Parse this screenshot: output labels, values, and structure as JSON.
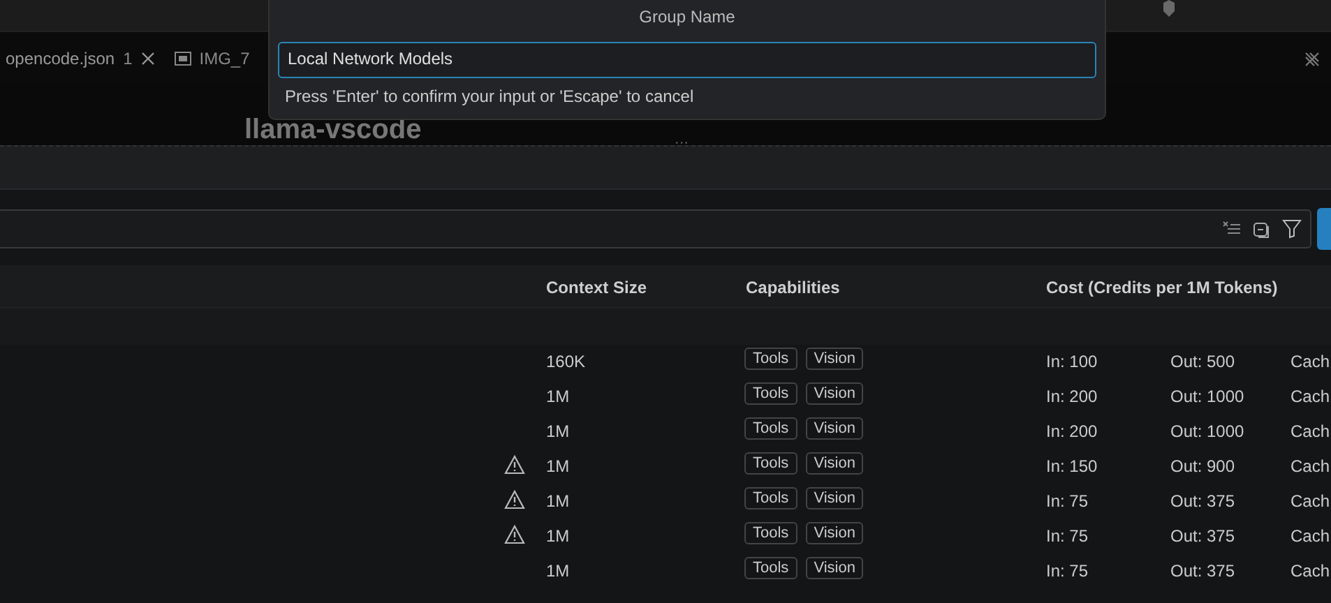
{
  "tabs": [
    {
      "label": "opencode.json",
      "problems": "1",
      "selected": true
    },
    {
      "label": "IMG_7",
      "selected": false
    }
  ],
  "editor": {
    "heading": "llama-vscode",
    "more": "···"
  },
  "dialog": {
    "title": "Group Name",
    "input_value": "Local Network Models",
    "hint": "Press 'Enter' to confirm your input or 'Escape' to cancel"
  },
  "table": {
    "columns": [
      "Context Size",
      "Capabilities",
      "Cost (Credits per 1M Tokens)"
    ],
    "rows": [
      {
        "warning": false,
        "context": "160K",
        "capabilities": [
          "Tools",
          "Vision"
        ],
        "cost_in": "In: 100",
        "cost_out": "Out: 500",
        "cache": "Cach"
      },
      {
        "warning": false,
        "context": "1M",
        "capabilities": [
          "Tools",
          "Vision"
        ],
        "cost_in": "In: 200",
        "cost_out": "Out: 1000",
        "cache": "Cach"
      },
      {
        "warning": false,
        "context": "1M",
        "capabilities": [
          "Tools",
          "Vision"
        ],
        "cost_in": "In: 200",
        "cost_out": "Out: 1000",
        "cache": "Cach"
      },
      {
        "warning": true,
        "context": "1M",
        "capabilities": [
          "Tools",
          "Vision"
        ],
        "cost_in": "In: 150",
        "cost_out": "Out: 900",
        "cache": "Cach"
      },
      {
        "warning": true,
        "context": "1M",
        "capabilities": [
          "Tools",
          "Vision"
        ],
        "cost_in": "In: 75",
        "cost_out": "Out: 375",
        "cache": "Cach"
      },
      {
        "warning": true,
        "context": "1M",
        "capabilities": [
          "Tools",
          "Vision"
        ],
        "cost_in": "In: 75",
        "cost_out": "Out: 375",
        "cache": "Cach"
      },
      {
        "warning": false,
        "context": "1M",
        "capabilities": [
          "Tools",
          "Vision"
        ],
        "cost_in": "In: 75",
        "cost_out": "Out: 375",
        "cache": "Cach"
      }
    ]
  }
}
